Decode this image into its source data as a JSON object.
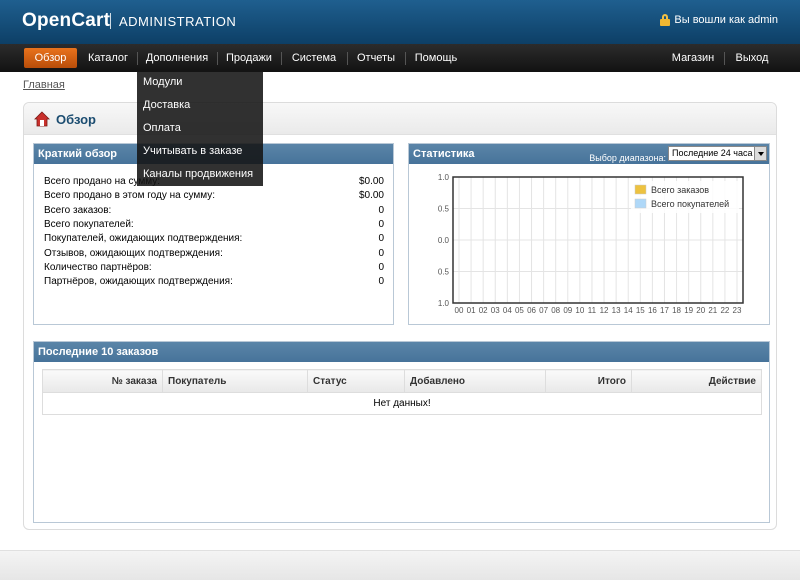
{
  "header": {
    "logo": "OpenCart",
    "subtitle": "ADMINISTRATION",
    "login_text": "Вы вошли как admin"
  },
  "menu": {
    "items": [
      "Обзор",
      "Каталог",
      "Дополнения",
      "Продажи",
      "Система",
      "Отчеты",
      "Помощь"
    ],
    "right": [
      "Магазин",
      "Выход"
    ]
  },
  "dropdown": {
    "items": [
      "Модули",
      "Доставка",
      "Оплата",
      "Учитывать в заказе",
      "Каналы продвижения"
    ]
  },
  "breadcrumb": "Главная",
  "page_title": "Обзор",
  "overview": {
    "title": "Краткий обзор",
    "rows": [
      {
        "label": "Всего продано на сумму:",
        "value": "$0.00"
      },
      {
        "label": "Всего продано в этом году на сумму:",
        "value": "$0.00"
      },
      {
        "label": "Всего заказов:",
        "value": "0"
      },
      {
        "label": "Всего покупателей:",
        "value": "0"
      },
      {
        "label": "Покупателей, ожидающих подтверждения:",
        "value": "0"
      },
      {
        "label": "Отзывов, ожидающих подтверждения:",
        "value": "0"
      },
      {
        "label": "Количество партнёров:",
        "value": "0"
      },
      {
        "label": "Партнёров, ожидающих подтверждения:",
        "value": "0"
      }
    ]
  },
  "statistics": {
    "title": "Статистика",
    "range_label": "Выбор диапазона:",
    "range_value": "Последние 24 часа"
  },
  "chart_data": {
    "type": "line",
    "x": [
      "00",
      "01",
      "02",
      "03",
      "04",
      "05",
      "06",
      "07",
      "08",
      "09",
      "10",
      "11",
      "12",
      "13",
      "14",
      "15",
      "16",
      "17",
      "18",
      "19",
      "20",
      "21",
      "22",
      "23"
    ],
    "y_ticks": [
      "1.0",
      "0.5",
      "0.0",
      "0.5",
      "1.0"
    ],
    "ylim": [
      -1.0,
      1.0
    ],
    "grid": true,
    "legend_position": "top-right",
    "series": [
      {
        "name": "Всего заказов",
        "color": "#edc240",
        "values": []
      },
      {
        "name": "Всего покупателей",
        "color": "#afd8f8",
        "values": []
      }
    ]
  },
  "orders": {
    "title": "Последние 10 заказов",
    "columns": [
      "№ заказа",
      "Покупатель",
      "Статус",
      "Добавлено",
      "Итого",
      "Действие"
    ],
    "empty_text": "Нет данных!"
  },
  "colors": {
    "accent": "#e16d16",
    "panel_header": "#4f7ba0",
    "header_bg": "#17507d"
  }
}
